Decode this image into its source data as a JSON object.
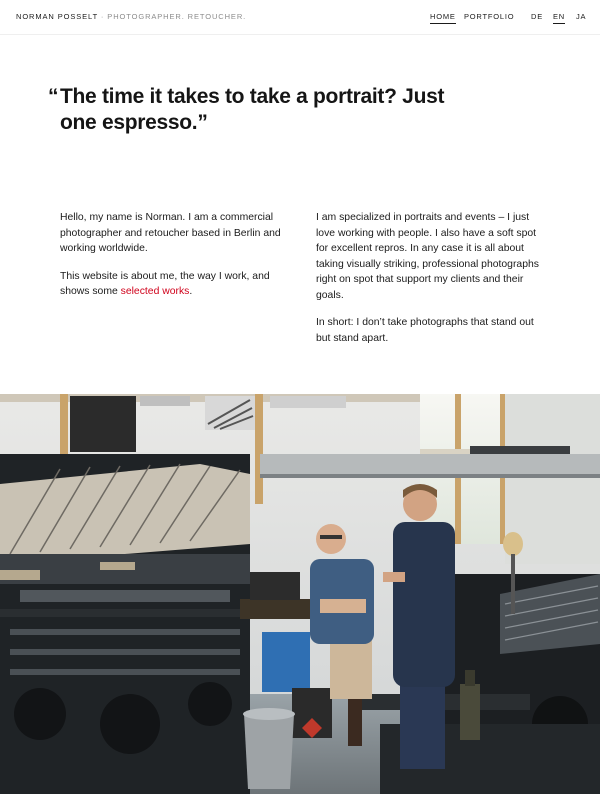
{
  "header": {
    "brand_name": "NORMAN POSSELT",
    "brand_separator": "·",
    "brand_tagline": "PHOTOGRAPHER. RETOUCHER.",
    "nav": {
      "home": "HOME",
      "portfolio": "PORTFOLIO"
    },
    "languages": {
      "de": "DE",
      "en": "EN",
      "ja": "JA"
    },
    "active_nav": "HOME",
    "active_language": "EN"
  },
  "quote": {
    "open_mark": "“",
    "line1": "The time it takes to take a portrait? Just",
    "line2": "one espresso.”"
  },
  "intro": {
    "left_p1": "Hello, my name is Norman. I am a commercial photographer and retoucher based in Berlin and working worldwide.",
    "left_p2_before": "This website is about me, the way I work, and shows some ",
    "left_p2_link": "selected works",
    "left_p2_after": ".",
    "right_p1": "I am specialized in portraits and events – I just love working with people. I also have a soft spot for excellent repros. In any case it is all about taking visually striking, professional photographs right on spot that support my clients and their goals.",
    "right_p2": "In short: I don’t take photographs that stand out but stand apart."
  },
  "colors": {
    "link": "#d0021b",
    "text": "#1b1b1b",
    "muted": "#8c8c8c"
  }
}
